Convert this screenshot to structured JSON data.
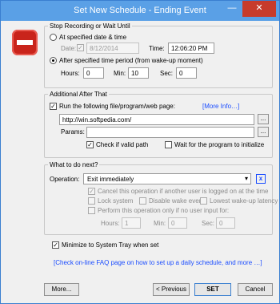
{
  "window": {
    "title": "Set New Schedule - Ending Event",
    "minimize": "—",
    "close": "✕"
  },
  "stop_section": {
    "legend": "Stop Recording or Wait Until",
    "at_date_label": "At specified date & time",
    "date_label": "Date:",
    "date_value": "8/12/2014",
    "time_label": "Time:",
    "time_value": "12:06:20 PM",
    "after_period_label": "After specified time period (from wake-up moment)",
    "hours_label": "Hours:",
    "hours_value": "0",
    "min_label": "Min:",
    "min_value": "10",
    "sec_label": "Sec:",
    "sec_value": "0"
  },
  "additional": {
    "legend": "Additional After That",
    "run_label": "Run the following file/program/web page:",
    "more_info": "[More Info…]",
    "path_value": "http://win.softpedia.com/",
    "browse": "...",
    "params_label": "Params:",
    "params_value": "",
    "check_valid_label": "Check if valid path",
    "wait_label": "Wait for the program to initialize"
  },
  "next": {
    "legend": "What to do next?",
    "operation_label": "Operation:",
    "operation_value": "Exit immediately",
    "help": "x",
    "cancel_label": "Cancel this operation if another user is logged on at the time",
    "lock_label": "Lock system",
    "disable_wake_label": "Disable wake events",
    "lowest_latency_label": "Lowest wake-up latency",
    "only_if_label": "Perform this operation only if no user input for:",
    "hours_label": "Hours:",
    "hours_value": "1",
    "min_label": "Min:",
    "min_value": "0",
    "sec_label": "Sec:",
    "sec_value": "0"
  },
  "minimize_label": "Minimize to System Tray when set",
  "faq_link": "[Check on-line FAQ page on how to set up a daily schedule, and more …]",
  "footer": {
    "more": "More...",
    "previous": "< Previous",
    "set": "SET",
    "cancel": "Cancel"
  }
}
